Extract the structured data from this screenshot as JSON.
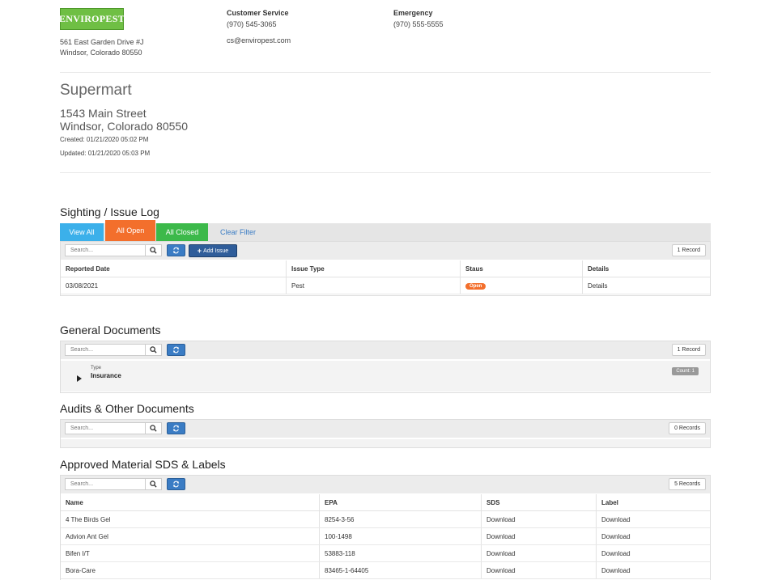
{
  "company": {
    "logo_text": "ENVIROPEST",
    "address_line1": "561 East Garden Drive #J",
    "address_line2": "Windsor, Colorado 80550",
    "customer_service_label": "Customer Service",
    "customer_service_phone": "(970) 545-3065",
    "customer_service_email": "cs@enviropest.com",
    "emergency_label": "Emergency",
    "emergency_phone": "(970) 555-5555"
  },
  "site": {
    "name": "Supermart",
    "street": "1543 Main Street",
    "city_state_zip": "Windsor, Colorado 80550",
    "created": "Created: 01/21/2020 05:02 PM",
    "updated": "Updated:  01/21/2020 05:03 PM"
  },
  "colors": {
    "view_all": "#3bb0ea",
    "all_open": "#f36f2c",
    "all_closed": "#3cb94a",
    "primary": "#3a7cc4"
  },
  "icons": {
    "search": "magnifier",
    "refresh": "refresh-arrows",
    "add": "plus",
    "expand": "triangle-right"
  },
  "sighting_log": {
    "title": "Sighting / Issue Log",
    "filters": {
      "view_all": "View All",
      "all_open": "All Open",
      "all_closed": "All Closed",
      "clear": "Clear Filter"
    },
    "search_placeholder": "Search...",
    "add_issue": "Add Issue",
    "record_count": "1 Record",
    "columns": [
      "Reported Date",
      "Issue Type",
      "Staus",
      "Details"
    ],
    "rows": [
      {
        "reported_date": "03/08/2021",
        "issue_type": "Pest",
        "status": "Open",
        "details": "Details"
      }
    ]
  },
  "general_documents": {
    "title": "General Documents",
    "search_placeholder": "Search...",
    "record_count": "1 Record",
    "group_label": "Type",
    "group_value": "Insurance",
    "group_count": "Count: 1"
  },
  "audits": {
    "title": "Audits & Other Documents",
    "search_placeholder": "Search...",
    "record_count": "0 Records"
  },
  "materials": {
    "title": "Approved Material SDS & Labels",
    "search_placeholder": "Search...",
    "record_count": "5 Records",
    "columns": [
      "Name",
      "EPA",
      "SDS",
      "Label"
    ],
    "rows": [
      {
        "name": "4 The Birds Gel",
        "epa": "8254-3-56",
        "sds": "Download",
        "label": "Download"
      },
      {
        "name": "Advion Ant Gel",
        "epa": "100-1498",
        "sds": "Download",
        "label": "Download"
      },
      {
        "name": "Bifen I/T",
        "epa": "53883-118",
        "sds": "Download",
        "label": "Download"
      },
      {
        "name": "Bora-Care",
        "epa": "83465-1-64405",
        "sds": "Download",
        "label": "Download"
      }
    ]
  }
}
